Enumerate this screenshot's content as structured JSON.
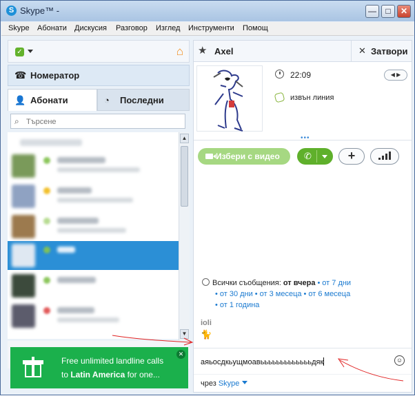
{
  "window": {
    "title": "Skype™ - ",
    "controls": [
      "minimize",
      "maximize",
      "close"
    ]
  },
  "menu": [
    "Skype",
    "Абонати",
    "Дискусия",
    "Разговор",
    "Изглед",
    "Инструменти",
    "Помощ"
  ],
  "left": {
    "dialer_label": "Номератор",
    "tabs": {
      "contacts": "Абонати",
      "recent": "Последни"
    },
    "search_placeholder": "Търсене",
    "ad": {
      "line1": "Free unlimited landline calls",
      "line2_prefix": "to ",
      "line2_bold": "Latin America",
      "line2_suffix": " for one..."
    }
  },
  "chat": {
    "contact_name": "Axel",
    "close_label": "Затвори",
    "local_time": "22:09",
    "status": "извън линия",
    "video_button": "Избери с видео",
    "history": {
      "prefix": "Всички съобщения: ",
      "current": "от вчера",
      "links": [
        "от 7 дни",
        "от 30 дни",
        "от 3 месеца",
        "от 6 месеца",
        "от 1 година"
      ]
    },
    "sender": "ioli",
    "compose_text": "аяьосдкьущмоавьььььььььььььдяк",
    "via_prefix": "чрез ",
    "via_service": "Skype"
  },
  "colors": {
    "accent_green": "#5fb02b",
    "selection_blue": "#2b8fd6",
    "link_blue": "#1a7ad0",
    "ad_green": "#1bb04c",
    "home_orange": "#f28c1a"
  }
}
